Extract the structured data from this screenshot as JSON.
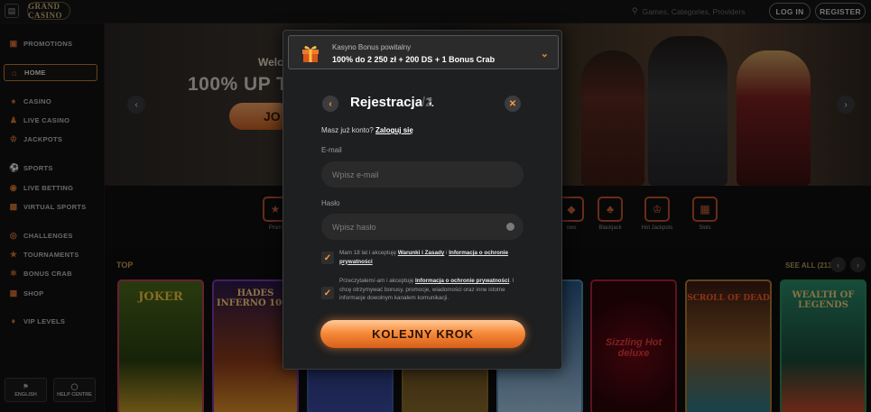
{
  "topbar": {
    "menu_icon": "sidebar-toggle-icon",
    "logo_text": "GRAND CASINO",
    "search_placeholder": "Games, Categories, Providers",
    "login_label": "LOG IN",
    "register_label": "REGISTER"
  },
  "sidebar": {
    "items": [
      {
        "label": "PROMOTIONS",
        "icon": "gift-icon"
      },
      {
        "label": "HOME",
        "icon": "home-icon"
      },
      {
        "label": "CASINO",
        "icon": "spade-icon"
      },
      {
        "label": "LIVE CASINO",
        "icon": "dealer-icon"
      },
      {
        "label": "JACKPOTS",
        "icon": "crown-icon"
      },
      {
        "label": "SPORTS",
        "icon": "ball-icon"
      },
      {
        "label": "LIVE BETTING",
        "icon": "live-icon"
      },
      {
        "label": "VIRTUAL SPORTS",
        "icon": "screen-icon"
      },
      {
        "label": "CHALLENGES",
        "icon": "target-icon"
      },
      {
        "label": "TOURNAMENTS",
        "icon": "trophy-icon"
      },
      {
        "label": "BONUS CRAB",
        "icon": "crab-icon"
      },
      {
        "label": "SHOP",
        "icon": "shop-icon"
      },
      {
        "label": "VIP LEVELS",
        "icon": "diamond-icon"
      }
    ],
    "active": "HOME",
    "language_label": "ENGLISH",
    "help_label": "HELP CENTRE"
  },
  "hero": {
    "welcome_text": "Welc",
    "headline": "100% UP TO",
    "cta": "JO"
  },
  "categories": [
    {
      "label": "Prom"
    },
    {
      "label": "ows"
    },
    {
      "label": "Blackjack"
    },
    {
      "label": "Hot Jackpots"
    },
    {
      "label": "Slots"
    }
  ],
  "games_section": {
    "title": "TOP",
    "see_all": "SEE ALL (213)",
    "games": [
      "JOKER",
      "HADES INFERNO 1000",
      "",
      "",
      "",
      "Sizzling Hot deluxe",
      "SCROLL OF DEAD",
      "WEALTH OF LEGENDS"
    ]
  },
  "modal": {
    "bonus_title": "Kasyno Bonus powitalny",
    "bonus_offer": "100% do 2 250 zł + 200 DS + 1 Bonus Crab",
    "title": "Rejestracja 1",
    "step_suffix": "/2",
    "has_account": "Masz już konto?",
    "login_link": "Zaloguj się",
    "email_label": "E-mail",
    "email_placeholder": "Wpisz e-mail",
    "password_label": "Hasło",
    "password_placeholder": "Wpisz hasło",
    "consent1_prefix": "Mam 18 lat i akceptuję",
    "consent1_link1": "Warunki i Zasady",
    "consent1_link2": "Informacja o ochronie prywatności",
    "consent2_prefix": "Przeczytałem/-am i akceptuję",
    "consent2_link": "Informacja o ochronie prywatności",
    "consent2_rest": ". I chcę otrzymywać bonusy, promocje, wiadomości oraz inne istotne informacje dowolnym kanałem komunikacji.",
    "next_button": "KOLEJNY KROK"
  },
  "colors": {
    "accent": "#f68b3b",
    "background": "#0d0d0e",
    "modal_bg": "#1e1f20"
  }
}
